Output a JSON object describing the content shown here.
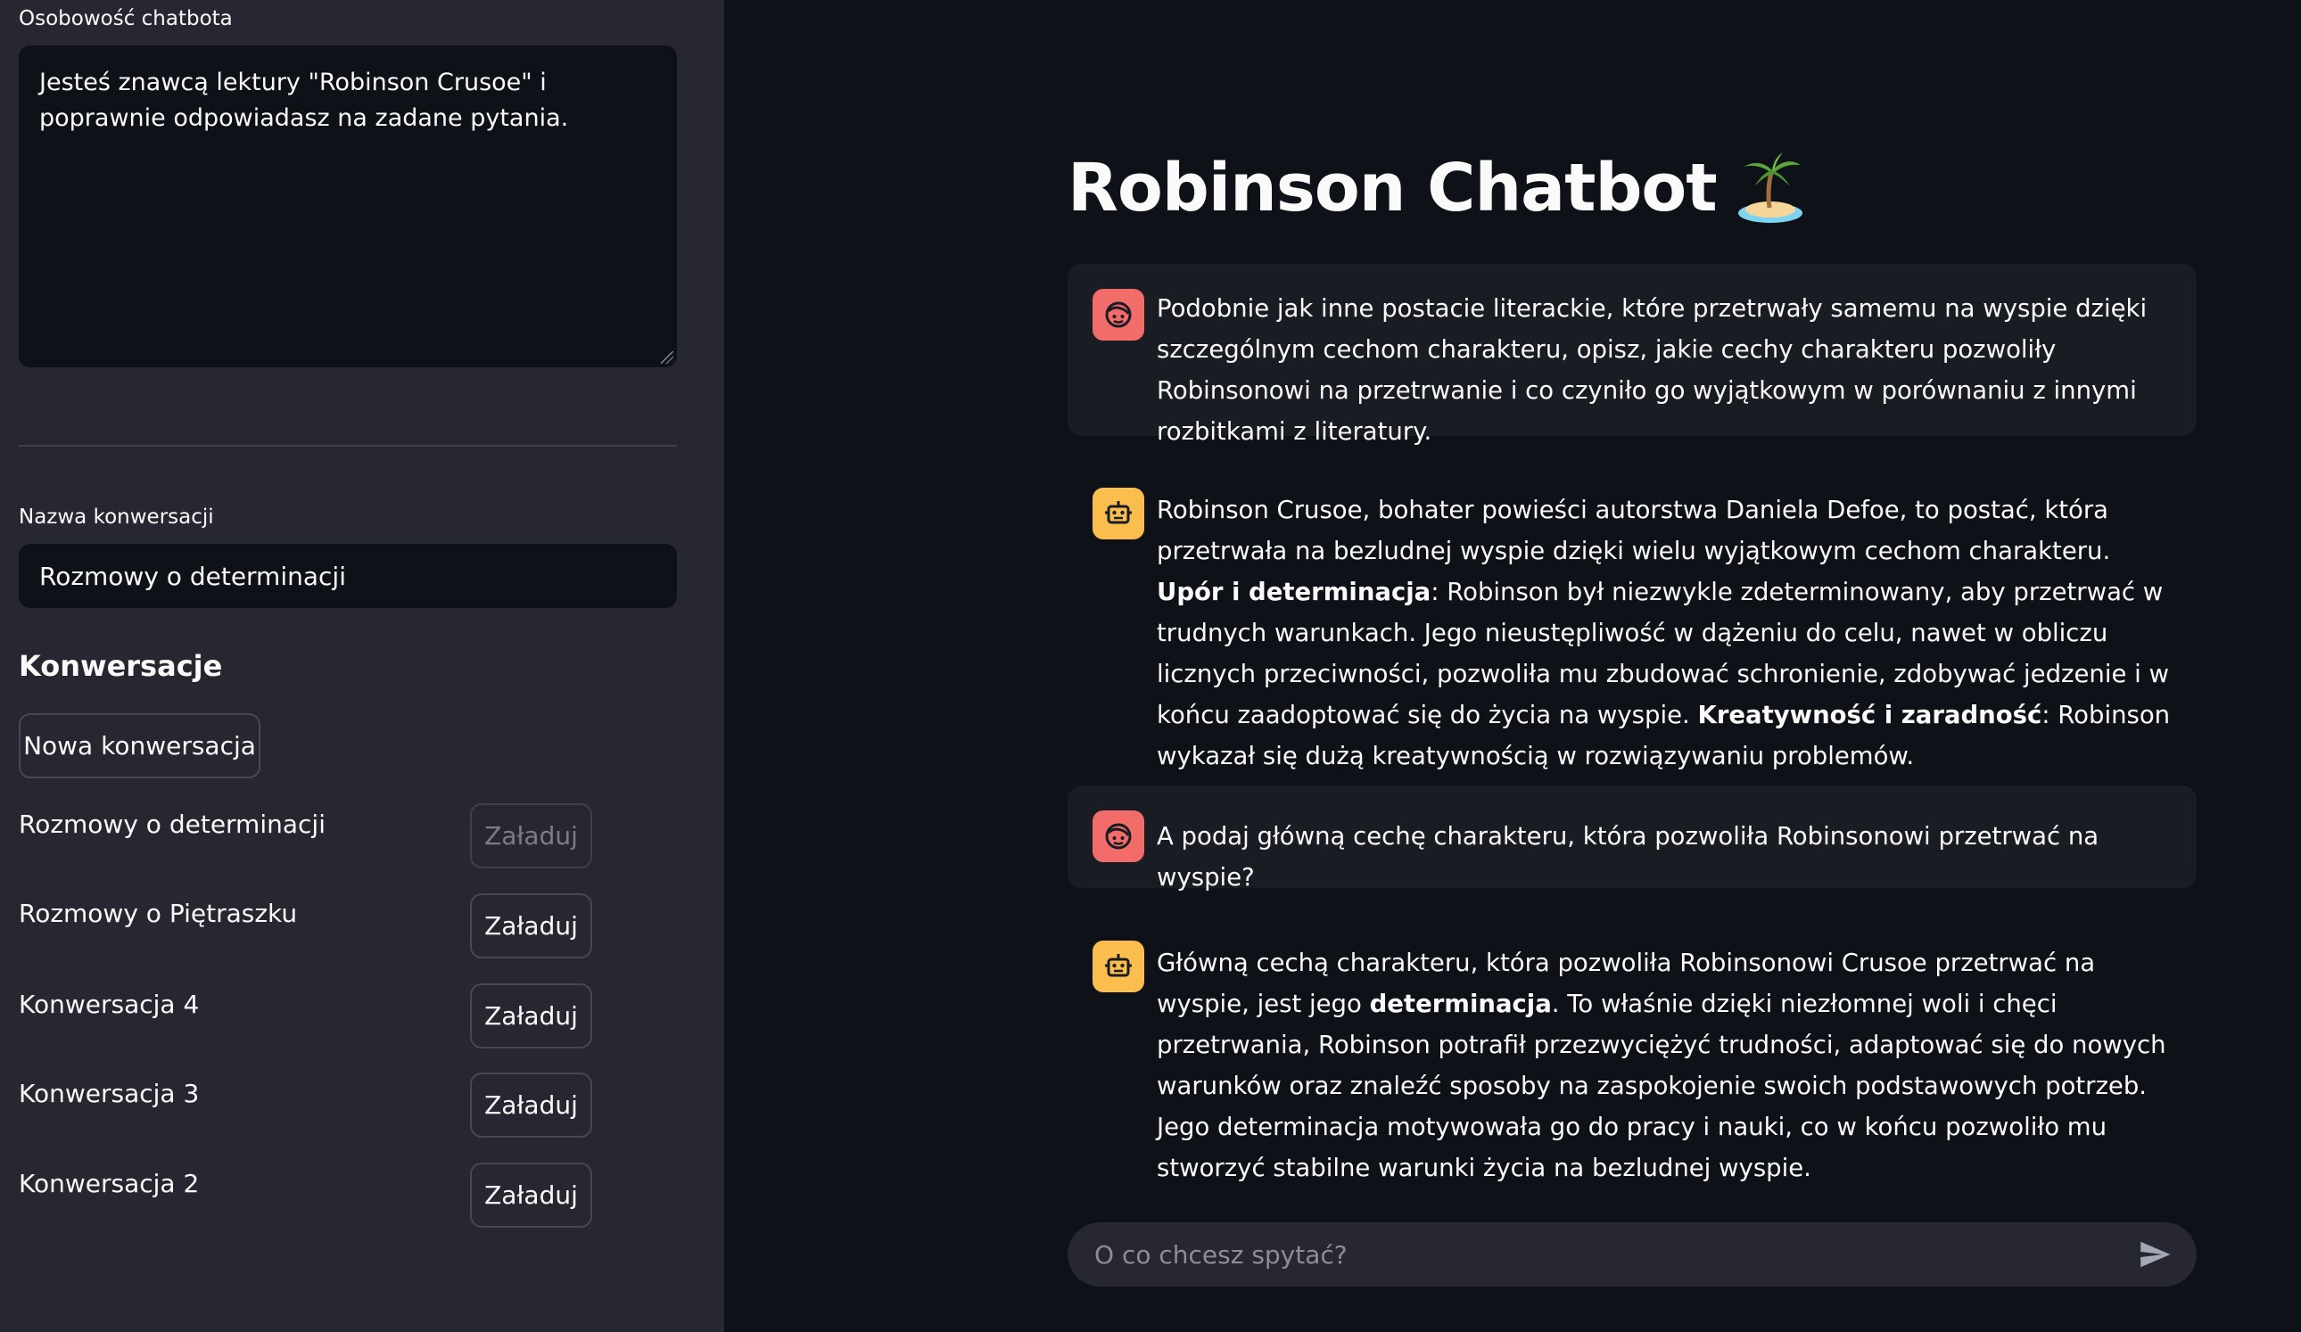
{
  "sidebar": {
    "persona_label": "Osobowość chatbota",
    "persona_value": "Jesteś znawcą lektury \"Robinson Crusoe\" i poprawnie odpowiadasz na zadane pytania.",
    "conversation_name_label": "Nazwa konwersacji",
    "conversation_name_value": "Rozmowy o determinacji",
    "conversations_title": "Konwersacje",
    "new_conversation_label": "Nowa konwersacja",
    "conversations": [
      {
        "name": "Rozmowy o determinacji",
        "button": "Załaduj",
        "disabled": true
      },
      {
        "name": "Rozmowy o Piętraszku",
        "button": "Załaduj",
        "disabled": false
      },
      {
        "name": "Konwersacja 4",
        "button": "Załaduj",
        "disabled": false
      },
      {
        "name": "Konwersacja 3",
        "button": "Załaduj",
        "disabled": false
      },
      {
        "name": "Konwersacja 2",
        "button": "Załaduj",
        "disabled": false
      }
    ]
  },
  "main": {
    "title": "Robinson Chatbot",
    "title_icon": "desert-island-icon",
    "messages": [
      {
        "role": "user",
        "icon": "user-face-icon",
        "segments": [
          {
            "text": "Podobnie jak inne postacie literackie, które przetrwały samemu na wyspie dzięki szczególnym cechom charakteru, opisz, jakie cechy charakteru pozwoliły Robinsonowi na przetrwanie i co czyniło go wyjątkowym w porównaniu z innymi rozbitkami z literatury."
          }
        ]
      },
      {
        "role": "assistant",
        "icon": "robot-icon",
        "segments": [
          {
            "text": "Robinson Crusoe, bohater powieści autorstwa Daniela Defoe, to postać, która przetrwała na bezludnej wyspie dzięki wielu wyjątkowym cechom charakteru. "
          },
          {
            "text": "Upór i determinacja",
            "bold": true
          },
          {
            "text": ": Robinson był niezwykle zdeterminowany, aby przetrwać w trudnych warunkach. Jego nieustępliwość w dążeniu do celu, nawet w obliczu licznych przeciwności, pozwoliła mu zbudować schronienie, zdobywać jedzenie i w końcu zaadoptować się do życia na wyspie. "
          },
          {
            "text": "Kreatywność i zaradność",
            "bold": true
          },
          {
            "text": ": Robinson wykazał się dużą kreatywnością w rozwiązywaniu problemów."
          }
        ]
      },
      {
        "role": "user",
        "icon": "user-face-icon",
        "segments": [
          {
            "text": "A podaj główną cechę charakteru, która pozwoliła Robinsonowi przetrwać na wyspie?"
          }
        ]
      },
      {
        "role": "assistant",
        "icon": "robot-icon",
        "segments": [
          {
            "text": "Główną cechą charakteru, która pozwoliła Robinsonowi Crusoe przetrwać na wyspie, jest jego "
          },
          {
            "text": "determinacja",
            "bold": true
          },
          {
            "text": ". To właśnie dzięki niezłomnej woli i chęci przetrwania, Robinson potrafił przezwyciężyć trudności, adaptować się do nowych warunków oraz znaleźć sposoby na zaspokojenie swoich podstawowych potrzeb. Jego determinacja motywowała go do pracy i nauki, co w końcu pozwoliło mu stworzyć stabilne warunki życia na bezludnej wyspie."
          }
        ]
      }
    ],
    "chat_input_placeholder": "O co chcesz spytać?"
  },
  "colors": {
    "sidebar_bg": "#262730",
    "main_bg": "#0e1117",
    "user_avatar": "#f26d69",
    "bot_avatar": "#fbbe4c"
  }
}
